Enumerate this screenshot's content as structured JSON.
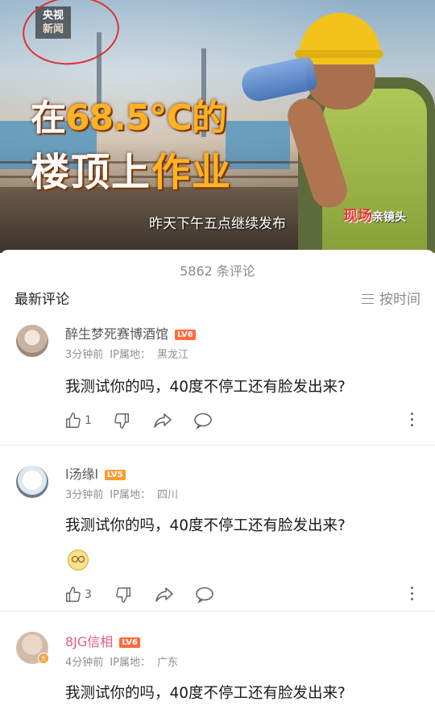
{
  "video": {
    "logo_line1": "央视",
    "logo_line2": "新闻",
    "headline_prefix": "在",
    "headline_temp": "68.5°C",
    "headline_suffix": "的",
    "headline_line2_a": "楼顶上",
    "headline_line2_b": "作业",
    "subtitle": "昨天下午五点继续发布",
    "scene_tag_a": "现场",
    "scene_tag_b": "亲镜头"
  },
  "comments_header": {
    "count_text": "5862 条评论",
    "latest_label": "最新评论",
    "sort_label": "按时间"
  },
  "comments": [
    {
      "username": "醉生梦死赛博酒馆",
      "level": "LV6",
      "time": "3分钟前",
      "ip_label": "IP属地：",
      "ip": "黑龙江",
      "text": "我测试你的吗，40度不停工还有脸发出来?",
      "likes": "1"
    },
    {
      "username": "l汤缘l",
      "level": "LV5",
      "time": "3分钟前",
      "ip_label": "IP属地：",
      "ip": "四川",
      "text": "我测试你的吗，40度不停工还有脸发出来?",
      "likes": "3"
    },
    {
      "username": "8JG信相",
      "level": "LV6",
      "time": "4分钟前",
      "ip_label": "IP属地：",
      "ip": "广东",
      "text": "我测试你的吗，40度不停工还有脸发出来?",
      "avatar_badge": "大"
    }
  ],
  "icons": {
    "like": "thumbs-up-icon",
    "dislike": "thumbs-down-icon",
    "share": "share-icon",
    "comment": "comment-bubble-icon",
    "more": "more-vertical-icon",
    "sort": "sort-lines-icon"
  },
  "colors": {
    "helmet": "#f3c31c",
    "headline_hot": "#ffb323",
    "username_pink": "#e05a8a",
    "level_badge": "#ff6a3c",
    "annotation_circle": "#e03030"
  }
}
